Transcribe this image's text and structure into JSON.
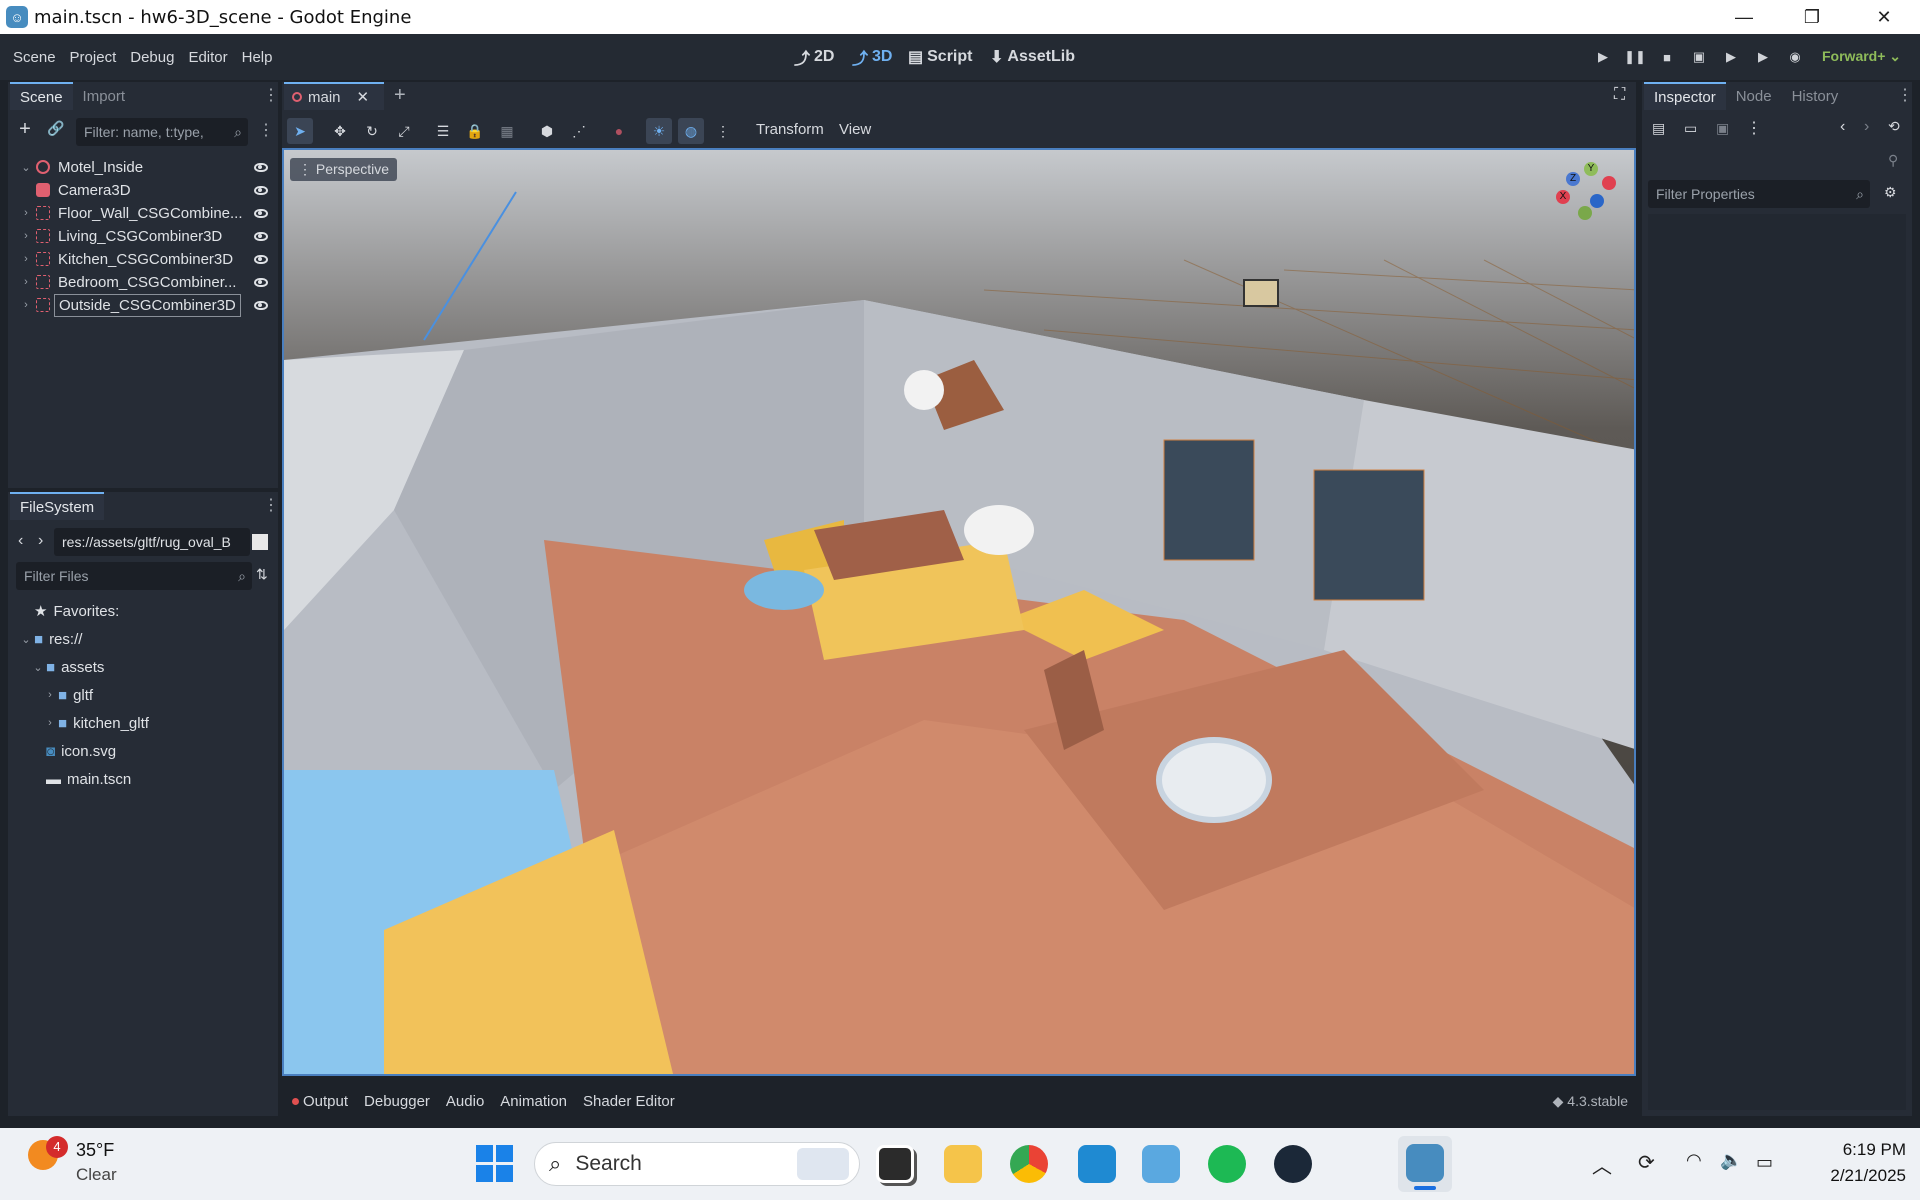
{
  "window": {
    "title": "main.tscn - hw6-3D_scene - Godot Engine"
  },
  "menu": [
    "Scene",
    "Project",
    "Debug",
    "Editor",
    "Help"
  ],
  "workspaces": [
    {
      "label": "2D",
      "icon": "2d-icon"
    },
    {
      "label": "3D",
      "icon": "3d-icon"
    },
    {
      "label": "Script",
      "icon": "script-icon"
    },
    {
      "label": "AssetLib",
      "icon": "assetlib-icon"
    }
  ],
  "renderer": "Forward+",
  "scene_dock": {
    "tabs": [
      "Scene",
      "Import"
    ],
    "filter_placeholder": "Filter: name, t:type,",
    "nodes": [
      {
        "label": "Motel_Inside",
        "icon": "node3d-icon"
      },
      {
        "label": "Camera3D",
        "icon": "camera-icon"
      },
      {
        "label": "Floor_Wall_CSGCombine...",
        "icon": "csg-icon"
      },
      {
        "label": "Living_CSGCombiner3D",
        "icon": "csg-icon"
      },
      {
        "label": "Kitchen_CSGCombiner3D",
        "icon": "csg-icon"
      },
      {
        "label": "Bedroom_CSGCombiner...",
        "icon": "csg-icon"
      },
      {
        "label": "Outside_CSGCombiner3D",
        "icon": "csg-icon"
      }
    ]
  },
  "filesystem_dock": {
    "tab": "FileSystem",
    "path": "res://assets/gltf/rug_oval_B",
    "filter_placeholder": "Filter Files",
    "items": [
      {
        "label": "Favorites:",
        "icon": "star-icon"
      },
      {
        "label": "res://",
        "icon": "folder-icon"
      },
      {
        "label": "assets",
        "icon": "folder-icon"
      },
      {
        "label": "gltf",
        "icon": "folder-icon"
      },
      {
        "label": "kitchen_gltf",
        "icon": "folder-icon"
      },
      {
        "label": "icon.svg",
        "icon": "image-icon"
      },
      {
        "label": "main.tscn",
        "icon": "scene-icon"
      }
    ]
  },
  "editor_tabs": {
    "active": "main"
  },
  "viewport_toolbar": {
    "transform": "Transform",
    "view": "View",
    "perspective": "Perspective"
  },
  "gizmo": {
    "x": "X",
    "y": "Y",
    "z": "Z"
  },
  "bottom_panel": {
    "tabs": [
      "Output",
      "Debugger",
      "Audio",
      "Animation",
      "Shader Editor"
    ],
    "version": "4.3.stable"
  },
  "inspector": {
    "tabs": [
      "Inspector",
      "Node",
      "History"
    ],
    "filter_placeholder": "Filter Properties"
  },
  "taskbar": {
    "weather_temp": "35°F",
    "weather_cond": "Clear",
    "weather_badge": "4",
    "search": "Search",
    "time": "6:19 PM",
    "date": "2/21/2025"
  },
  "colors": {
    "accent": "#6fb0f0",
    "run_green": "#8fbc5a",
    "csg": "#e06070"
  }
}
